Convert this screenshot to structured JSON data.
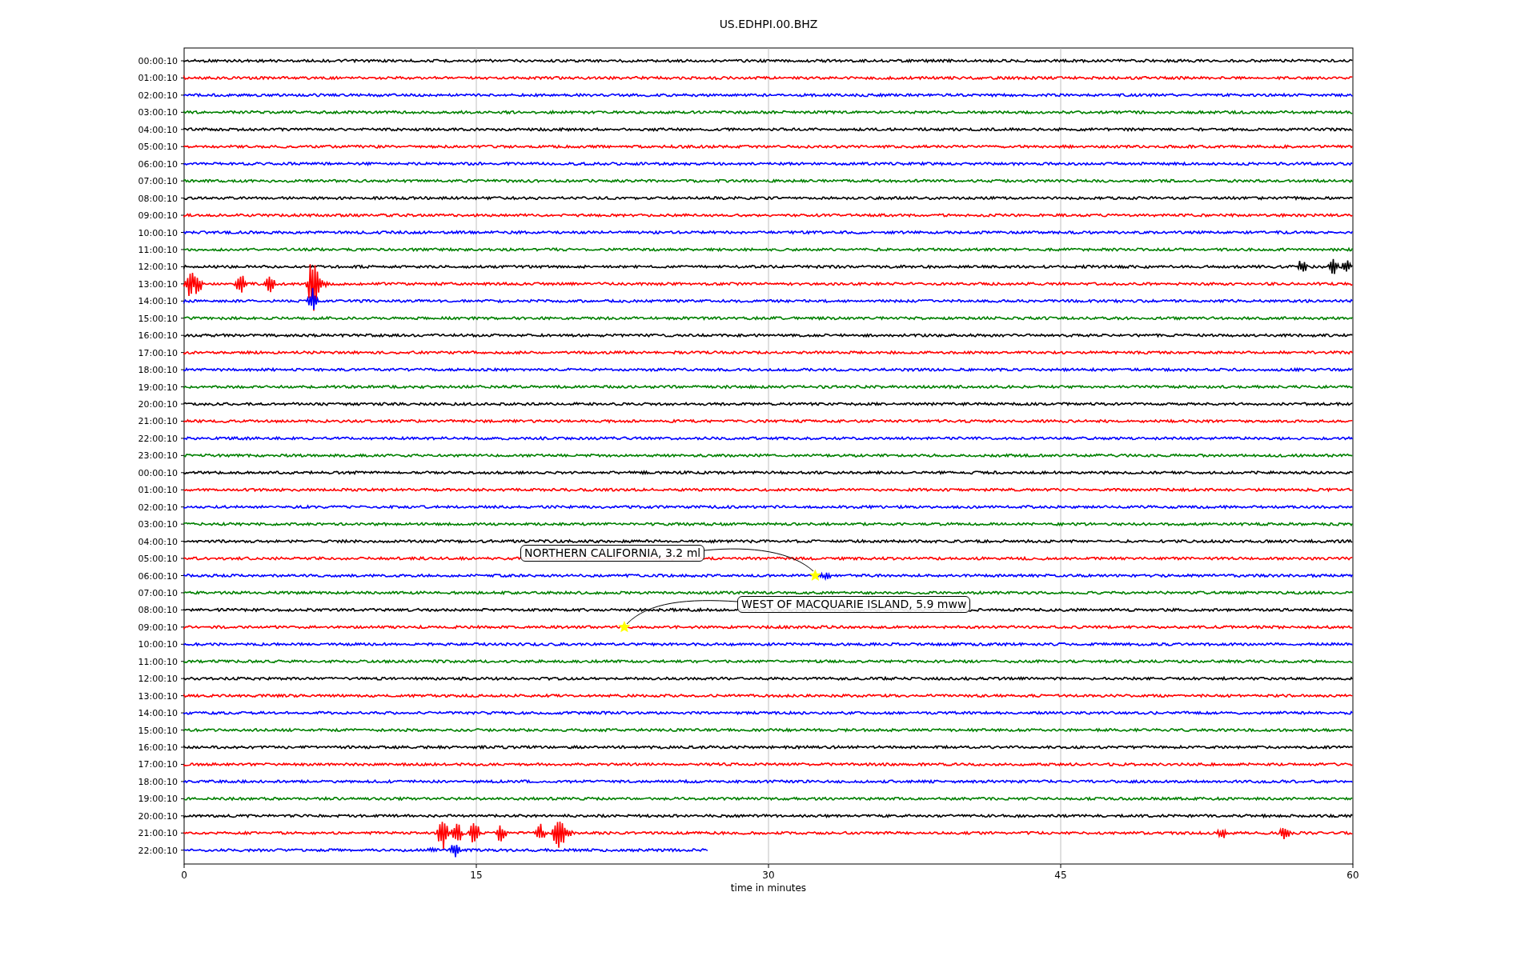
{
  "plot": {
    "title": "US.EDHPI.00.BHZ",
    "xlabel": "time in minutes",
    "xticks": [
      "0",
      "15",
      "30",
      "45",
      "60"
    ],
    "rows": [
      {
        "label": "00:00:10",
        "color": "#000000"
      },
      {
        "label": "01:00:10",
        "color": "#ff0000"
      },
      {
        "label": "02:00:10",
        "color": "#0000ff"
      },
      {
        "label": "03:00:10",
        "color": "#008000"
      },
      {
        "label": "04:00:10",
        "color": "#000000"
      },
      {
        "label": "05:00:10",
        "color": "#ff0000"
      },
      {
        "label": "06:00:10",
        "color": "#0000ff"
      },
      {
        "label": "07:00:10",
        "color": "#008000"
      },
      {
        "label": "08:00:10",
        "color": "#000000"
      },
      {
        "label": "09:00:10",
        "color": "#ff0000"
      },
      {
        "label": "10:00:10",
        "color": "#0000ff"
      },
      {
        "label": "11:00:10",
        "color": "#008000"
      },
      {
        "label": "12:00:10",
        "color": "#000000"
      },
      {
        "label": "13:00:10",
        "color": "#ff0000"
      },
      {
        "label": "14:00:10",
        "color": "#0000ff"
      },
      {
        "label": "15:00:10",
        "color": "#008000"
      },
      {
        "label": "16:00:10",
        "color": "#000000"
      },
      {
        "label": "17:00:10",
        "color": "#ff0000"
      },
      {
        "label": "18:00:10",
        "color": "#0000ff"
      },
      {
        "label": "19:00:10",
        "color": "#008000"
      },
      {
        "label": "20:00:10",
        "color": "#000000"
      },
      {
        "label": "21:00:10",
        "color": "#ff0000"
      },
      {
        "label": "22:00:10",
        "color": "#0000ff"
      },
      {
        "label": "23:00:10",
        "color": "#008000"
      },
      {
        "label": "00:00:10",
        "color": "#000000"
      },
      {
        "label": "01:00:10",
        "color": "#ff0000"
      },
      {
        "label": "02:00:10",
        "color": "#0000ff"
      },
      {
        "label": "03:00:10",
        "color": "#008000"
      },
      {
        "label": "04:00:10",
        "color": "#000000"
      },
      {
        "label": "05:00:10",
        "color": "#ff0000"
      },
      {
        "label": "06:00:10",
        "color": "#0000ff"
      },
      {
        "label": "07:00:10",
        "color": "#008000"
      },
      {
        "label": "08:00:10",
        "color": "#000000"
      },
      {
        "label": "09:00:10",
        "color": "#ff0000"
      },
      {
        "label": "10:00:10",
        "color": "#0000ff"
      },
      {
        "label": "11:00:10",
        "color": "#008000"
      },
      {
        "label": "12:00:10",
        "color": "#000000"
      },
      {
        "label": "13:00:10",
        "color": "#ff0000"
      },
      {
        "label": "14:00:10",
        "color": "#0000ff"
      },
      {
        "label": "15:00:10",
        "color": "#008000"
      },
      {
        "label": "16:00:10",
        "color": "#000000"
      },
      {
        "label": "17:00:10",
        "color": "#ff0000"
      },
      {
        "label": "18:00:10",
        "color": "#0000ff"
      },
      {
        "label": "19:00:10",
        "color": "#008000"
      },
      {
        "label": "20:00:10",
        "color": "#000000"
      },
      {
        "label": "21:00:10",
        "color": "#ff0000"
      },
      {
        "label": "22:00:10",
        "color": "#0000ff"
      }
    ],
    "events": [
      {
        "text": "NORTHERN CALIFORNIA, 3.2 ml"
      },
      {
        "text": "WEST OF MACQUARIE ISLAND, 5.9 mww"
      }
    ]
  }
}
